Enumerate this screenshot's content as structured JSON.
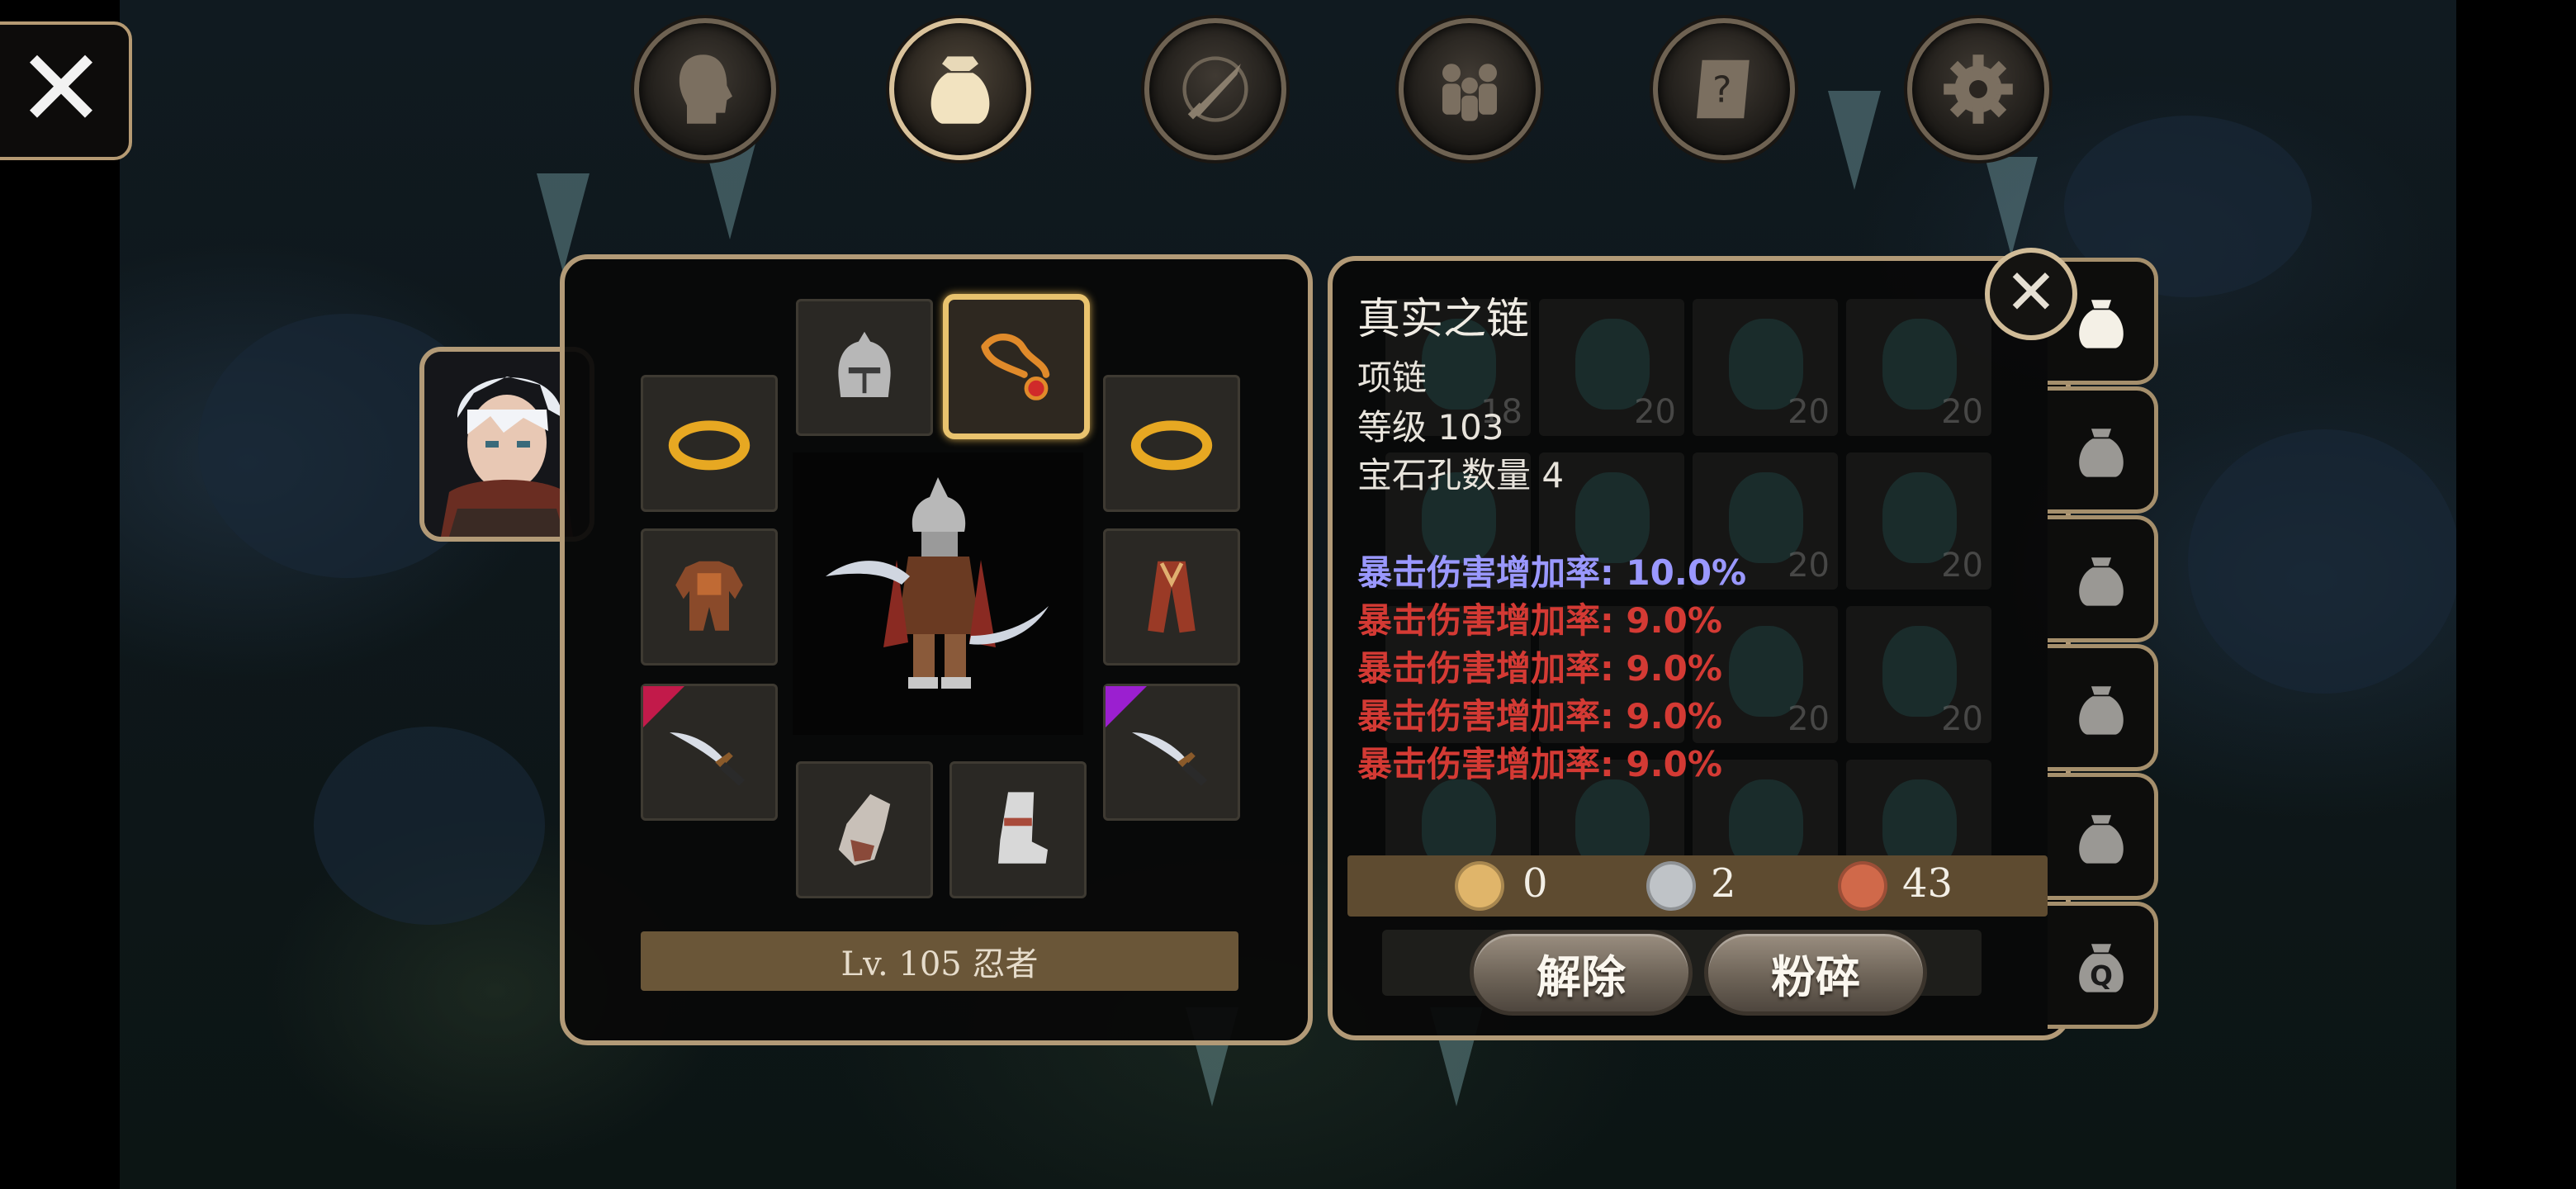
{
  "colors": {
    "frame": "#b29a77",
    "selected_slot": "#e9c36e",
    "stat_primary": "#9a98ff",
    "stat_secondary": "#d43a34",
    "level_bar": "#6a5638",
    "currency_bar": "#5e4b30"
  },
  "top_menu": [
    {
      "icon": "character-head-icon",
      "active": false
    },
    {
      "icon": "inventory-bag-icon",
      "active": true
    },
    {
      "icon": "skills-sword-icon",
      "active": false
    },
    {
      "icon": "party-icon",
      "active": false
    },
    {
      "icon": "quest-scroll-icon",
      "active": false
    },
    {
      "icon": "settings-gear-icon",
      "active": false
    }
  ],
  "close_icon": "✕",
  "equipment": {
    "level_label": "Lv. 105 忍者",
    "slots": [
      {
        "slot": "helmet",
        "icon": "helmet-icon"
      },
      {
        "slot": "necklace",
        "icon": "necklace-icon",
        "selected": true
      },
      {
        "slot": "ring-left",
        "icon": "gold-ring-icon"
      },
      {
        "slot": "ring-right",
        "icon": "gold-ring-icon"
      },
      {
        "slot": "armor",
        "icon": "armor-icon"
      },
      {
        "slot": "cloak",
        "icon": "cloak-icon"
      },
      {
        "slot": "weapon-left",
        "icon": "dagger-icon",
        "rarity_color": "#c21a4a"
      },
      {
        "slot": "weapon-right",
        "icon": "dagger-icon",
        "rarity_color": "#9b1fd0"
      },
      {
        "slot": "gloves",
        "icon": "gauntlet-icon"
      },
      {
        "slot": "boots",
        "icon": "boots-icon"
      }
    ]
  },
  "inventory_counts": [
    "18",
    "20",
    "20",
    "20",
    "20",
    "20",
    "20",
    "20",
    "20",
    "20"
  ],
  "item_tooltip": {
    "name": "真实之链",
    "type": "项链",
    "level": "等级 103",
    "sockets": "宝石孔数量 4",
    "stats": [
      {
        "text": "暴击伤害增加率: 10.0%",
        "tier": "primary"
      },
      {
        "text": "暴击伤害增加率: 9.0%",
        "tier": "secondary"
      },
      {
        "text": "暴击伤害增加率: 9.0%",
        "tier": "secondary"
      },
      {
        "text": "暴击伤害增加率: 9.0%",
        "tier": "secondary"
      },
      {
        "text": "暴击伤害增加率: 9.0%",
        "tier": "secondary"
      }
    ]
  },
  "currency": {
    "gold": {
      "label": "G",
      "value": "0",
      "color": "#e0b56a"
    },
    "silver": {
      "label": "S",
      "value": "2",
      "color": "#bfc3c7"
    },
    "copper": {
      "label": "C",
      "value": "43",
      "color": "#d0694a"
    }
  },
  "actions": {
    "unequip": "解除",
    "smash": "粉碎"
  },
  "bag_tabs": [
    "bag-tab-1",
    "bag-tab-2",
    "bag-tab-3",
    "bag-tab-4",
    "bag-tab-5",
    "bag-tab-quest"
  ],
  "bag_tab_quest_label": "Q"
}
